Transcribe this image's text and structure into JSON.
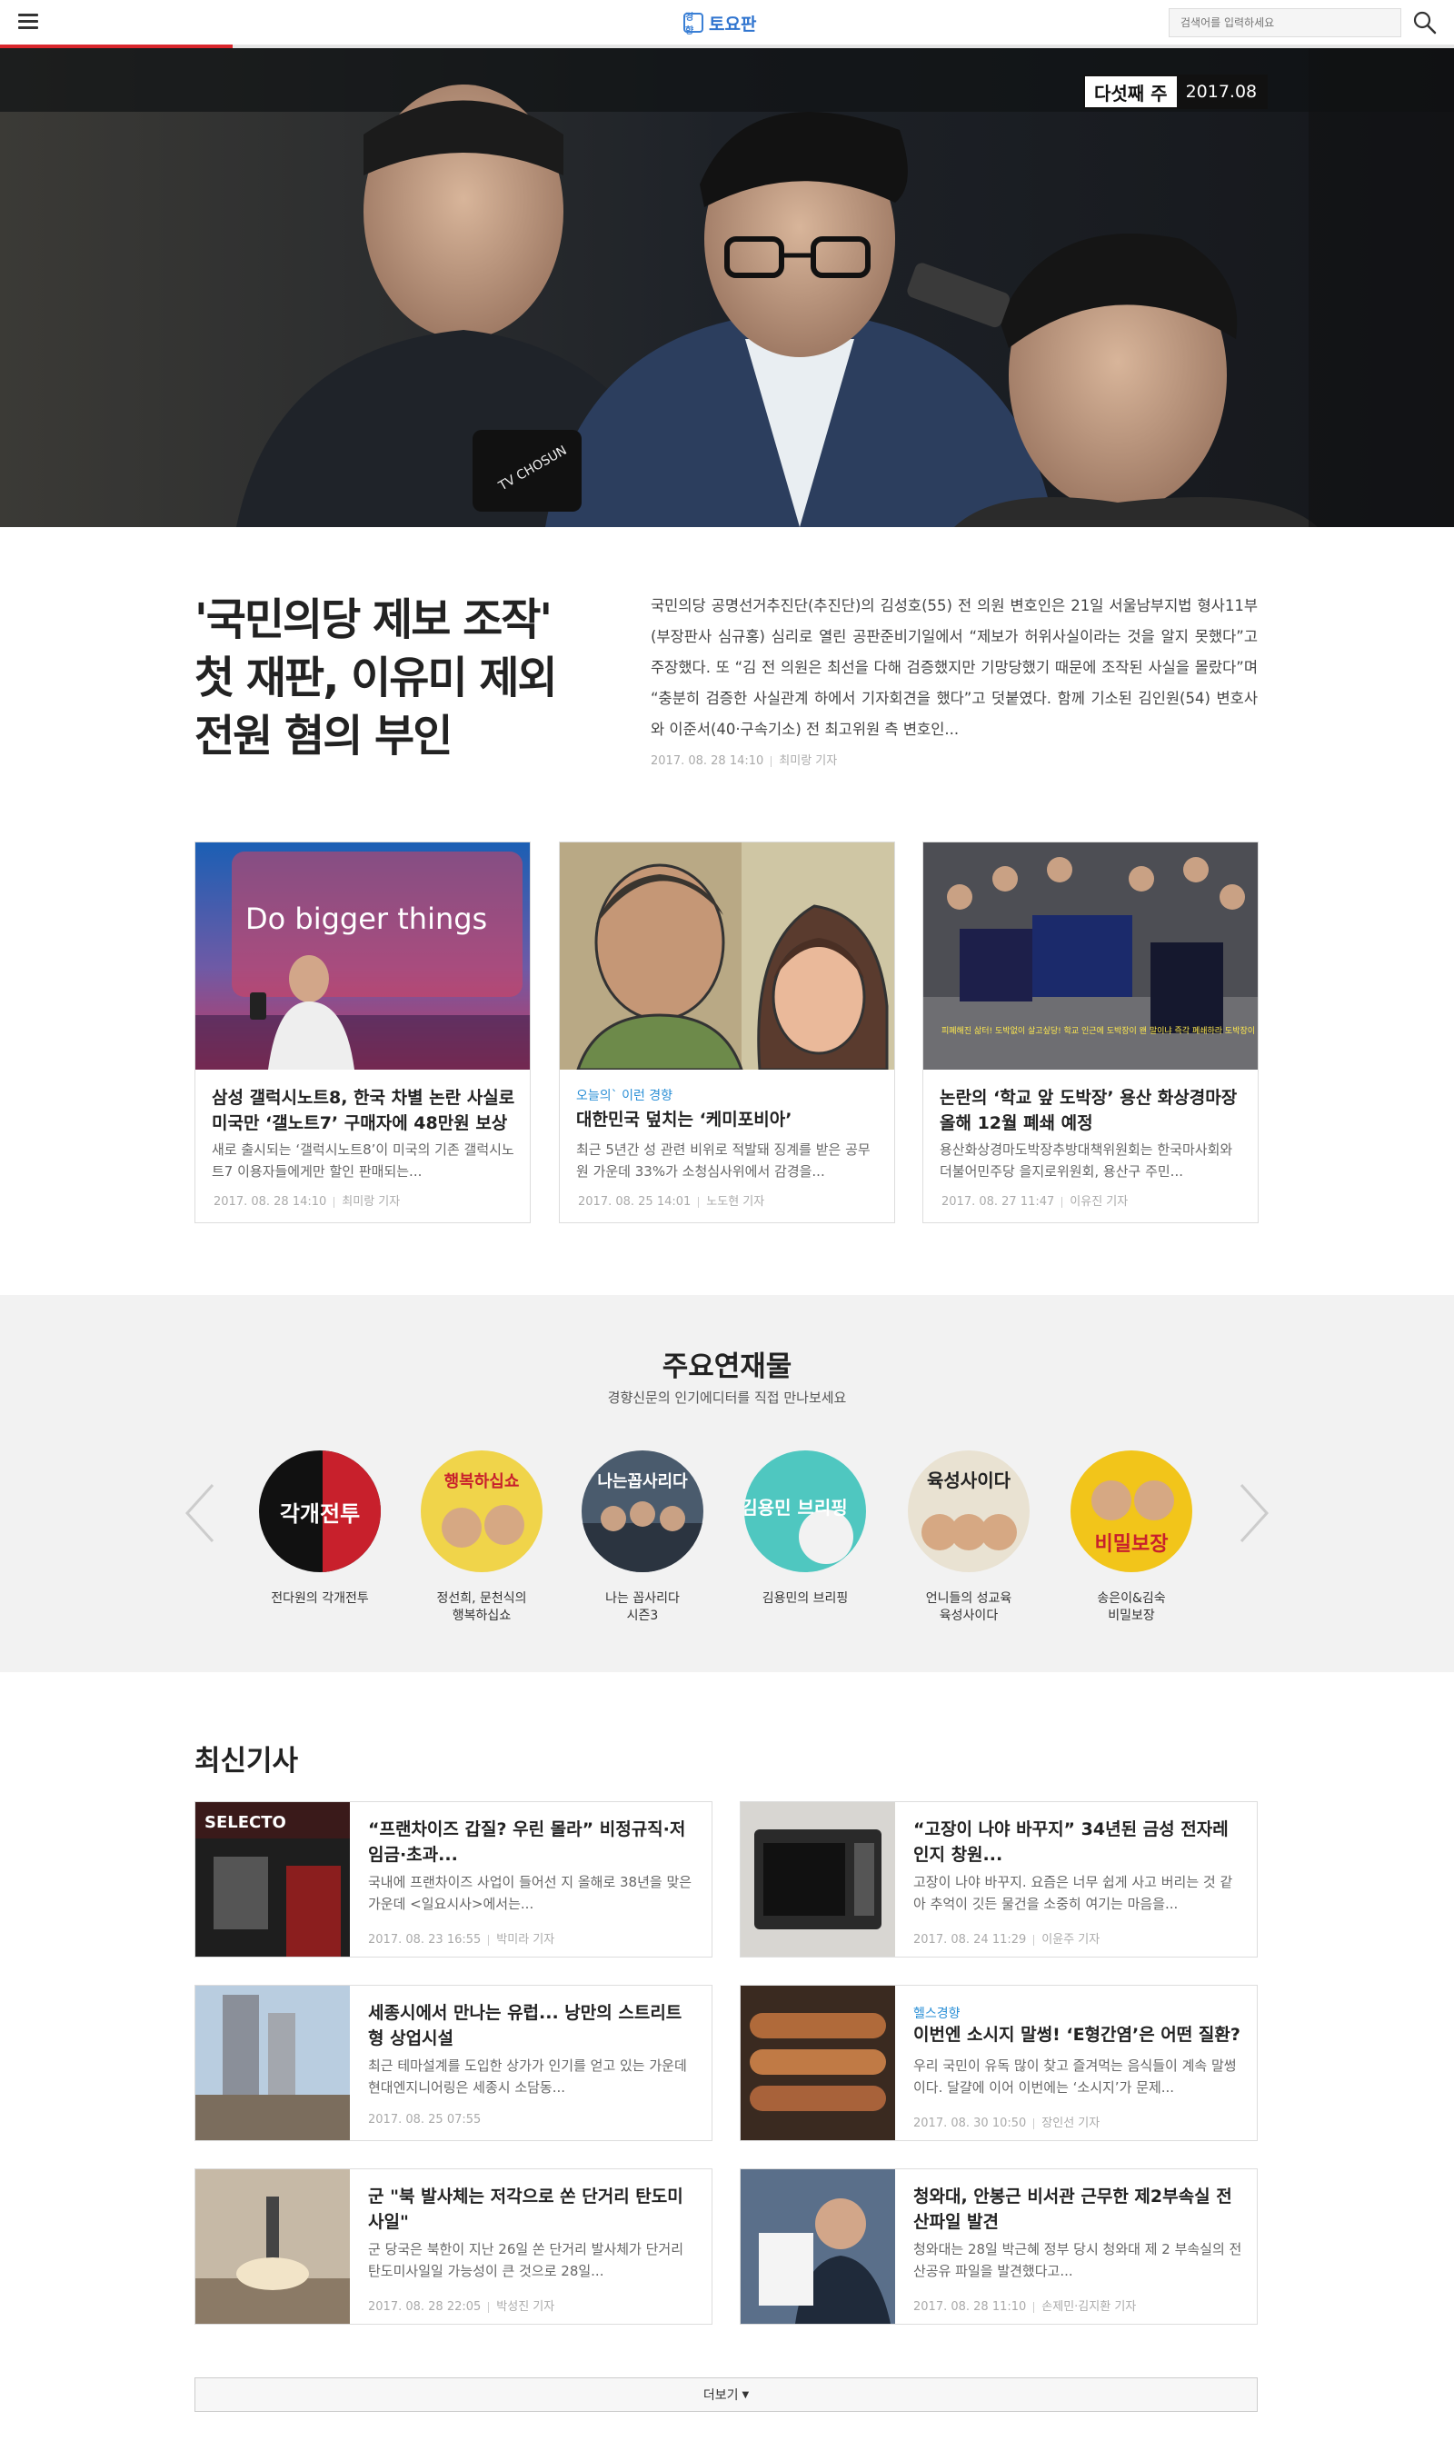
{
  "header": {
    "logo_mark": "경향",
    "logo_text": "토요판",
    "search_placeholder": "검색어를 입력하세요",
    "reading_progress": 0.16
  },
  "hero": {
    "week_label": "다섯째 주",
    "date_label": "2017.08",
    "photo_watermark": "TV CHOSUN"
  },
  "lead": {
    "title_lines": [
      "'국민의당 제보 조작'",
      "첫 재판, 이유미 제외",
      "전원 혐의 부인"
    ],
    "body": "국민의당 공명선거추진단(추진단)의 김성호(55) 전 의원 변호인은 21일 서울남부지법 형사11부(부장판사 심규홍) 심리로 열린 공판준비기일에서 “제보가 허위사실이라는 것을 알지 못했다”고 주장했다. 또 “김 전 의원은 최선을 다해 검증했지만 기망당했기 때문에 조작된 사실을 몰랐다”며 “충분히 검증한 사실관계 하에서 기자회견을 했다”고 덧붙였다. 함께 기소된 김인원(54) 변호사와 이준서(40·구속기소) 전 최고위원 측 변호인...",
    "date": "2017. 08. 28 14:10",
    "author": "최미랑 기자"
  },
  "cards": [
    {
      "category": "",
      "title": "삼성 갤럭시노트8, 한국 차별 논란 사실로 미국만 ‘갤노트7’ 구매자에 48만원 보상",
      "desc": "새로 출시되는 ‘갤럭시노트8’이 미국의 기존 갤럭시노트7 이용자들에게만 할인 판매되는...",
      "date": "2017. 08. 28 14:10",
      "author": "최미랑 기자",
      "image_text": "Do bigger things"
    },
    {
      "category": "오늘의` 이런 경향",
      "title": "대한민국 덮치는 ‘케미포비아’",
      "desc": "최근 5년간 성 관련 비위로 적발돼 징계를 받은 공무원 가운데 33%가 소청심사위에서 감경을...",
      "date": "2017. 08. 25 14:01",
      "author": "노도현 기자",
      "image_text": ""
    },
    {
      "category": "",
      "title": "논란의 ‘학교 앞 도박장’ 용산 화상경마장 올해 12월 폐쇄 예정",
      "desc": "용산화상경마도박장추방대책위원회는 한국마사회와 더불어민주당 을지로위원회, 용산구 주민...",
      "date": "2017. 08. 27 11:47",
      "author": "이유진 기자",
      "image_text": "피폐해진 삶터! 도박없이 살고싶당! 학교 인근에 도박장이 왠 말이냐 즉각 폐쇄하라 도박장이 아웃이다 이건 아니지~!"
    }
  ],
  "serial": {
    "title": "주요연재물",
    "subtitle": "경향신문의 인기에디터를 직접 만나보세요",
    "items": [
      {
        "label": "전다원의 각개전투",
        "art_text": "각개전투"
      },
      {
        "label": "정선희, 문천식의\n행복하십쇼",
        "art_text": "행복하십쇼"
      },
      {
        "label": "나는 꼽사리다\n시즌3",
        "art_text": "나는꼽사리다"
      },
      {
        "label": "김용민의 브리핑",
        "art_text": "김용민 브리핑"
      },
      {
        "label": "언니들의 성교육\n육성사이다",
        "art_text": "육성사이다"
      },
      {
        "label": "송은이&김숙\n비밀보장",
        "art_text": "비밀보장"
      }
    ]
  },
  "latest": {
    "title": "최신기사",
    "articles": [
      {
        "category": "",
        "title": "“프랜차이즈 갑질? 우린 몰라” 비정규직·저임금·초과...",
        "desc": "국내에 프랜차이즈 사업이 들어선 지 올해로 38년을 맞은 가운데 <일요시사>에서는...",
        "date": "2017. 08. 23 16:55",
        "author": "박미라 기자"
      },
      {
        "category": "",
        "title": "“고장이 나야 바꾸지” 34년된 금성 전자레인지 창원...",
        "desc": "고장이 나야 바꾸지. 요즘은 너무 쉽게 사고 버리는 것 같아 추억이 깃든 물건을 소중히 여기는 마음을...",
        "date": "2017. 08. 24 11:29",
        "author": "이윤주 기자"
      },
      {
        "category": "",
        "title": "세종시에서 만나는 유럽... 낭만의 스트리트형 상업시설",
        "desc": "최근 테마설계를 도입한 상가가 인기를 얻고 있는 가운데 현대엔지니어링은 세종시 소담동...",
        "date": "2017. 08. 25 07:55",
        "author": ""
      },
      {
        "category": "헬스경향",
        "title": "이번엔 소시지 말썽! ‘E형간염’은 어떤 질환?",
        "desc": "우리 국민이 유독 많이 찾고 즐겨먹는 음식들이 계속 말썽이다. 달걀에 이어 이번에는 ‘소시지’가 문제...",
        "date": "2017. 08. 30 10:50",
        "author": "장인선 기자"
      },
      {
        "category": "",
        "title": "군 \"북 발사체는 저각으로 쏜 단거리 탄도미사일\"",
        "desc": "군 당국은 북한이 지난 26일 쏜 단거리 발사체가 단거리 탄도미사일일 가능성이 큰 것으로 28일...",
        "date": "2017. 08. 28 22:05",
        "author": "박성진 기자"
      },
      {
        "category": "",
        "title": "청와대, 안봉근 비서관 근무한 제2부속실 전산파일 발견",
        "desc": "청와대는 28일 박근혜 정부 당시 청와대 제 2 부속실의 전산공유 파일을 발견했다고...",
        "date": "2017. 08. 28 11:10",
        "author": "손제민·김지환 기자"
      }
    ]
  },
  "more_button": "더보기",
  "colors": {
    "accent": "#2a8fd6",
    "progress": "#d9262c",
    "logo": "#2f74cf"
  }
}
